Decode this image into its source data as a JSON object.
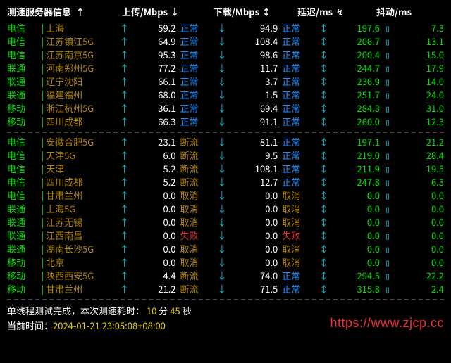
{
  "header": {
    "server_info": "测速服务器信息",
    "upload": "上传/Mbps",
    "download": "下载/Mbps",
    "latency": "延迟/ms",
    "jitter": "抖动/ms",
    "arr_up": "↑",
    "arr_down": "↓",
    "arr_updown": "↕",
    "arr_bolt": "↯"
  },
  "groups": [
    {
      "rows": [
        {
          "isp": "电信",
          "loc": "上海",
          "up": "59.2",
          "ust": "正常",
          "dn": "94.9",
          "dst": "正常",
          "lat": "197.6",
          "jit": "7.3"
        },
        {
          "isp": "电信",
          "loc": "江苏镇江5G",
          "up": "64.9",
          "ust": "正常",
          "dn": "108.4",
          "dst": "正常",
          "lat": "206.7",
          "jit": "13.1"
        },
        {
          "isp": "电信",
          "loc": "江苏南京5G",
          "up": "95.3",
          "ust": "正常",
          "dn": "98.6",
          "dst": "正常",
          "lat": "200.4",
          "jit": "15.0"
        },
        {
          "isp": "联通",
          "loc": "河南郑州5G",
          "up": "77.2",
          "ust": "正常",
          "dn": "11.7",
          "dst": "正常",
          "lat": "244.7",
          "jit": "17.9"
        },
        {
          "isp": "联通",
          "loc": "辽宁沈阳",
          "up": "66.1",
          "ust": "正常",
          "dn": "3.7",
          "dst": "正常",
          "lat": "236.9",
          "jit": "14.0"
        },
        {
          "isp": "联通",
          "loc": "福建福州",
          "up": "68.0",
          "ust": "正常",
          "dn": "1.5",
          "dst": "正常",
          "lat": "251.7",
          "jit": "24.0"
        },
        {
          "isp": "移动",
          "loc": "浙江杭州5G",
          "up": "36.1",
          "ust": "正常",
          "dn": "69.4",
          "dst": "正常",
          "lat": "284.3",
          "jit": "31.0"
        },
        {
          "isp": "移动",
          "loc": "四川成都",
          "up": "66.3",
          "ust": "正常",
          "dn": "91.1",
          "dst": "正常",
          "lat": "260.0",
          "jit": "12.3"
        }
      ]
    },
    {
      "rows": [
        {
          "isp": "电信",
          "loc": "安徽合肥5G",
          "up": "23.1",
          "ust": "断流",
          "dn": "81.1",
          "dst": "正常",
          "lat": "197.1",
          "jit": "21.2"
        },
        {
          "isp": "电信",
          "loc": "天津5G",
          "up": "6.0",
          "ust": "断流",
          "dn": "9.5",
          "dst": "正常",
          "lat": "219.0",
          "jit": "28.4"
        },
        {
          "isp": "电信",
          "loc": "天津",
          "up": "5.2",
          "ust": "断流",
          "dn": "108.1",
          "dst": "正常",
          "lat": "211.9",
          "jit": "19.5"
        },
        {
          "isp": "电信",
          "loc": "四川成都",
          "up": "5.2",
          "ust": "断流",
          "dn": "12.7",
          "dst": "正常",
          "lat": "247.8",
          "jit": "6.3"
        },
        {
          "isp": "电信",
          "loc": "甘肃兰州",
          "up": "0.0",
          "ust": "取消",
          "dn": "0.0",
          "dst": "取消",
          "lat": "0.0",
          "jit": "0.0"
        },
        {
          "isp": "联通",
          "loc": "上海5G",
          "up": "0.0",
          "ust": "取消",
          "dn": "0.0",
          "dst": "取消",
          "lat": "0.0",
          "jit": "0.0"
        },
        {
          "isp": "联通",
          "loc": "江苏无锡",
          "up": "0.0",
          "ust": "取消",
          "dn": "0.0",
          "dst": "取消",
          "lat": "0.0",
          "jit": "0.0"
        },
        {
          "isp": "联通",
          "loc": "江西南昌",
          "up": "0.0",
          "ust": "失败",
          "dn": "0.0",
          "dst": "失败",
          "lat": "0.0",
          "jit": "0.0"
        },
        {
          "isp": "联通",
          "loc": "湖南长沙5G",
          "up": "0.0",
          "ust": "取消",
          "dn": "0.0",
          "dst": "取消",
          "lat": "0.0",
          "jit": "0.0"
        },
        {
          "isp": "移动",
          "loc": "北京",
          "up": "0.0",
          "ust": "取消",
          "dn": "0.0",
          "dst": "取消",
          "lat": "0.0",
          "jit": "0.0"
        },
        {
          "isp": "移动",
          "loc": "陕西西安5G",
          "up": "4.4",
          "ust": "断流",
          "dn": "74.0",
          "dst": "正常",
          "lat": "294.5",
          "jit": "22.2"
        },
        {
          "isp": "移动",
          "loc": "甘肃兰州",
          "up": "21.2",
          "ust": "断流",
          "dn": "71.5",
          "dst": "正常",
          "lat": "315.8",
          "jit": "2.4"
        }
      ]
    }
  ],
  "footer": {
    "line1_prefix": "单线程测试完成，本次测速耗时：",
    "minutes": "10",
    "min_unit": "分",
    "seconds": "45",
    "sec_unit": "秒",
    "line2_prefix": "当前时间：",
    "timestamp": "2024-01-21 23:05:08+08:00"
  },
  "watermark": "https://www.zjcp.cc",
  "status_map": {
    "正常": "blue",
    "断流": "orange",
    "取消": "orange",
    "失败": "red"
  },
  "arrows": {
    "up": "↑",
    "down": "↓",
    "updown": "↕",
    "stop": "▯"
  }
}
